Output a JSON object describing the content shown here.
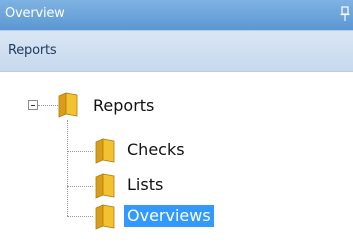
{
  "titlebar": {
    "title": "Overview",
    "pin_icon": "pin-icon"
  },
  "subbar": {
    "label": "Reports"
  },
  "tree": {
    "root": {
      "label": "Reports",
      "icon": "folder-open-icon",
      "expanded": true,
      "expander_icon": "minus-expander-icon"
    },
    "children": [
      {
        "label": "Checks",
        "icon": "folder-icon"
      },
      {
        "label": "Lists",
        "icon": "folder-icon"
      },
      {
        "label": "Overviews",
        "icon": "folder-icon",
        "selected": true
      }
    ]
  },
  "colors": {
    "titlebar": "#5b97d3",
    "subbar": "#c7d9ee",
    "folder": "#f2c230",
    "selection": "#3399ff"
  }
}
